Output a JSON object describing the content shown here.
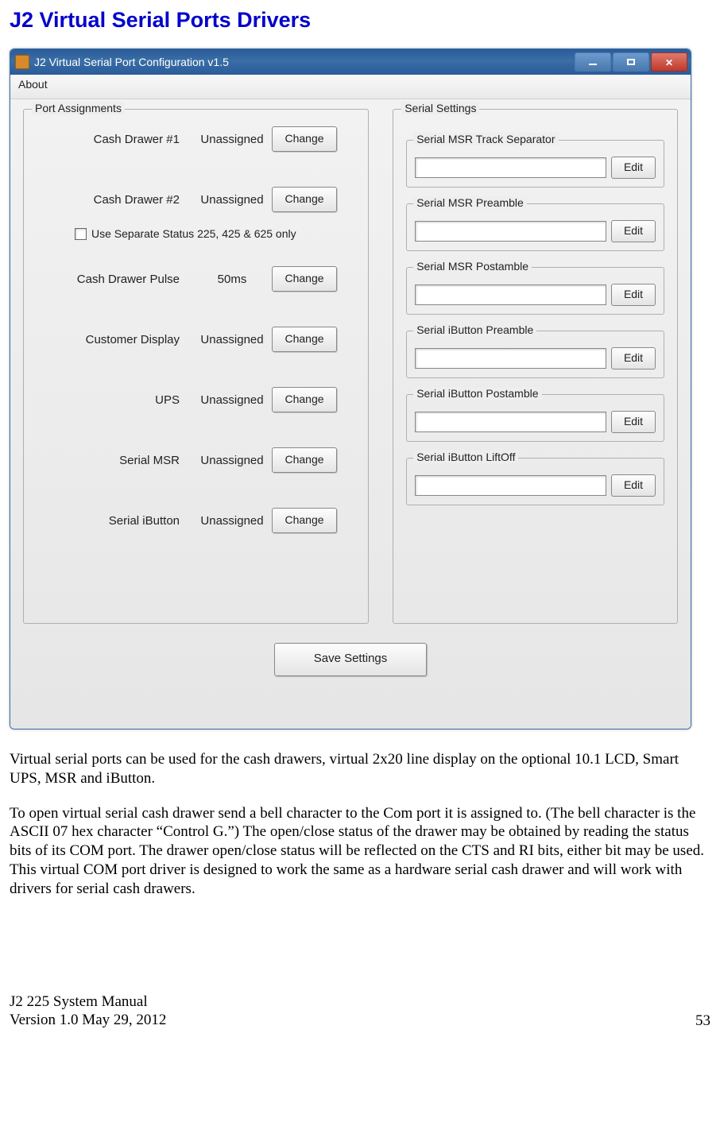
{
  "page": {
    "heading": "J2 Virtual Serial Ports Drivers",
    "window_title": "J2 Virtual Serial Port Configuration  v1.5",
    "menu_about": "About",
    "group_port": "Port Assignments",
    "group_serial": "Serial Settings",
    "port_rows": [
      {
        "label": "Cash Drawer #1",
        "value": "Unassigned",
        "btn": "Change"
      },
      {
        "label": "Cash Drawer #2",
        "value": "Unassigned",
        "btn": "Change"
      },
      {
        "label": "Cash Drawer Pulse",
        "value": "50ms",
        "btn": "Change"
      },
      {
        "label": "Customer Display",
        "value": "Unassigned",
        "btn": "Change"
      },
      {
        "label": "UPS",
        "value": "Unassigned",
        "btn": "Change"
      },
      {
        "label": "Serial MSR",
        "value": "Unassigned",
        "btn": "Change"
      },
      {
        "label": "Serial  iButton",
        "value": "Unassigned",
        "btn": "Change"
      }
    ],
    "checkbox_label": "Use Separate Status 225, 425 & 625 only",
    "serial_groups": [
      {
        "legend": "Serial MSR Track Separator",
        "btn": "Edit"
      },
      {
        "legend": "Serial MSR Preamble",
        "btn": "Edit"
      },
      {
        "legend": "Serial MSR Postamble",
        "btn": "Edit"
      },
      {
        "legend": "Serial iButton Preamble",
        "btn": "Edit"
      },
      {
        "legend": "Serial iButton Postamble",
        "btn": "Edit"
      },
      {
        "legend": "Serial iButton LiftOff",
        "btn": "Edit"
      }
    ],
    "save_btn": "Save Settings",
    "para1": "Virtual serial ports can be used for the cash drawers, virtual 2x20 line display on the optional 10.1 LCD, Smart UPS, MSR and iButton.",
    "para2": "To open virtual serial cash drawer send a bell character to the Com port it is assigned to. (The bell character is the ASCII 07 hex character “Control G.”)  The open/close status of the drawer may be obtained by reading the status bits of its COM port. The drawer open/close status will be reflected on the CTS and RI bits, either bit may be used. This virtual COM port driver is designed to work the same as a hardware serial cash drawer and will work with drivers for serial cash drawers.",
    "footer_line1": "J2 225 System Manual",
    "footer_line2": "Version 1.0 May 29, 2012",
    "page_number": "53"
  }
}
